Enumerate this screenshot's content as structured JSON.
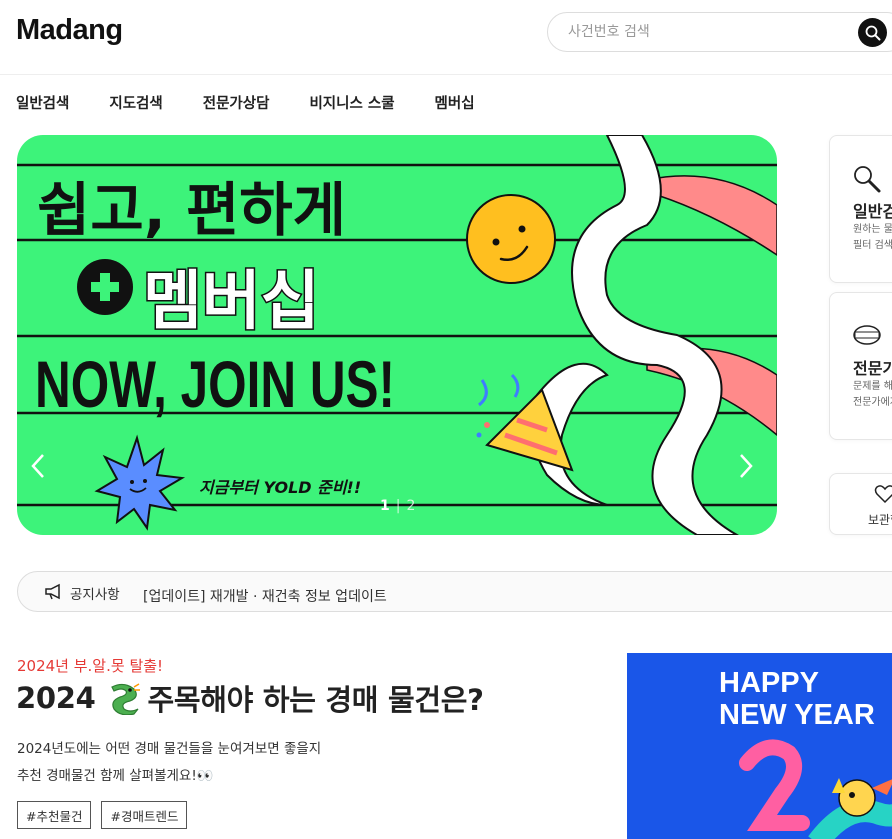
{
  "header": {
    "logo": "Madang",
    "search": {
      "placeholder": "사건번호 검색"
    }
  },
  "nav": {
    "items": [
      "일반검색",
      "지도검색",
      "전문가상담",
      "비지니스 스쿨",
      "멤버십"
    ]
  },
  "banner": {
    "headline": "쉽고, 편하게",
    "membership": "멤버십",
    "tagline": "NOW, JOIN US!",
    "subline": "지금부터 YOLD 준비!!",
    "pager_current": "1",
    "pager_separator": "|",
    "pager_total": "2",
    "bg_color": "#3df37a"
  },
  "side_cards": [
    {
      "title": "일반검색",
      "desc_line1": "원하는 물건을",
      "desc_line2": "필터 검색"
    },
    {
      "title": "전문가",
      "desc_line1": "문제를 해결",
      "desc_line2": "전문가에게"
    }
  ],
  "favorite": {
    "label": "보관함"
  },
  "notice": {
    "label": "공지사항",
    "text": "[업데이트] 재개발 · 재건축 정보 업데이트"
  },
  "article": {
    "kicker": "2024년 부.알.못 탈출!",
    "title_year": "2024",
    "title_rest": "주목해야 하는 경매 물건은?",
    "desc_line1": "2024년도에는 어떤 경매 물건들을 눈여겨보면 좋을지",
    "desc_line2": "추천 경매물건 함께 살펴볼게요!👀",
    "tags": [
      "#추천물건",
      "#경매트렌드"
    ]
  },
  "promo": {
    "line1": "HAPPY",
    "line2": "NEW YEAR",
    "bg_color": "#1a56e8"
  }
}
